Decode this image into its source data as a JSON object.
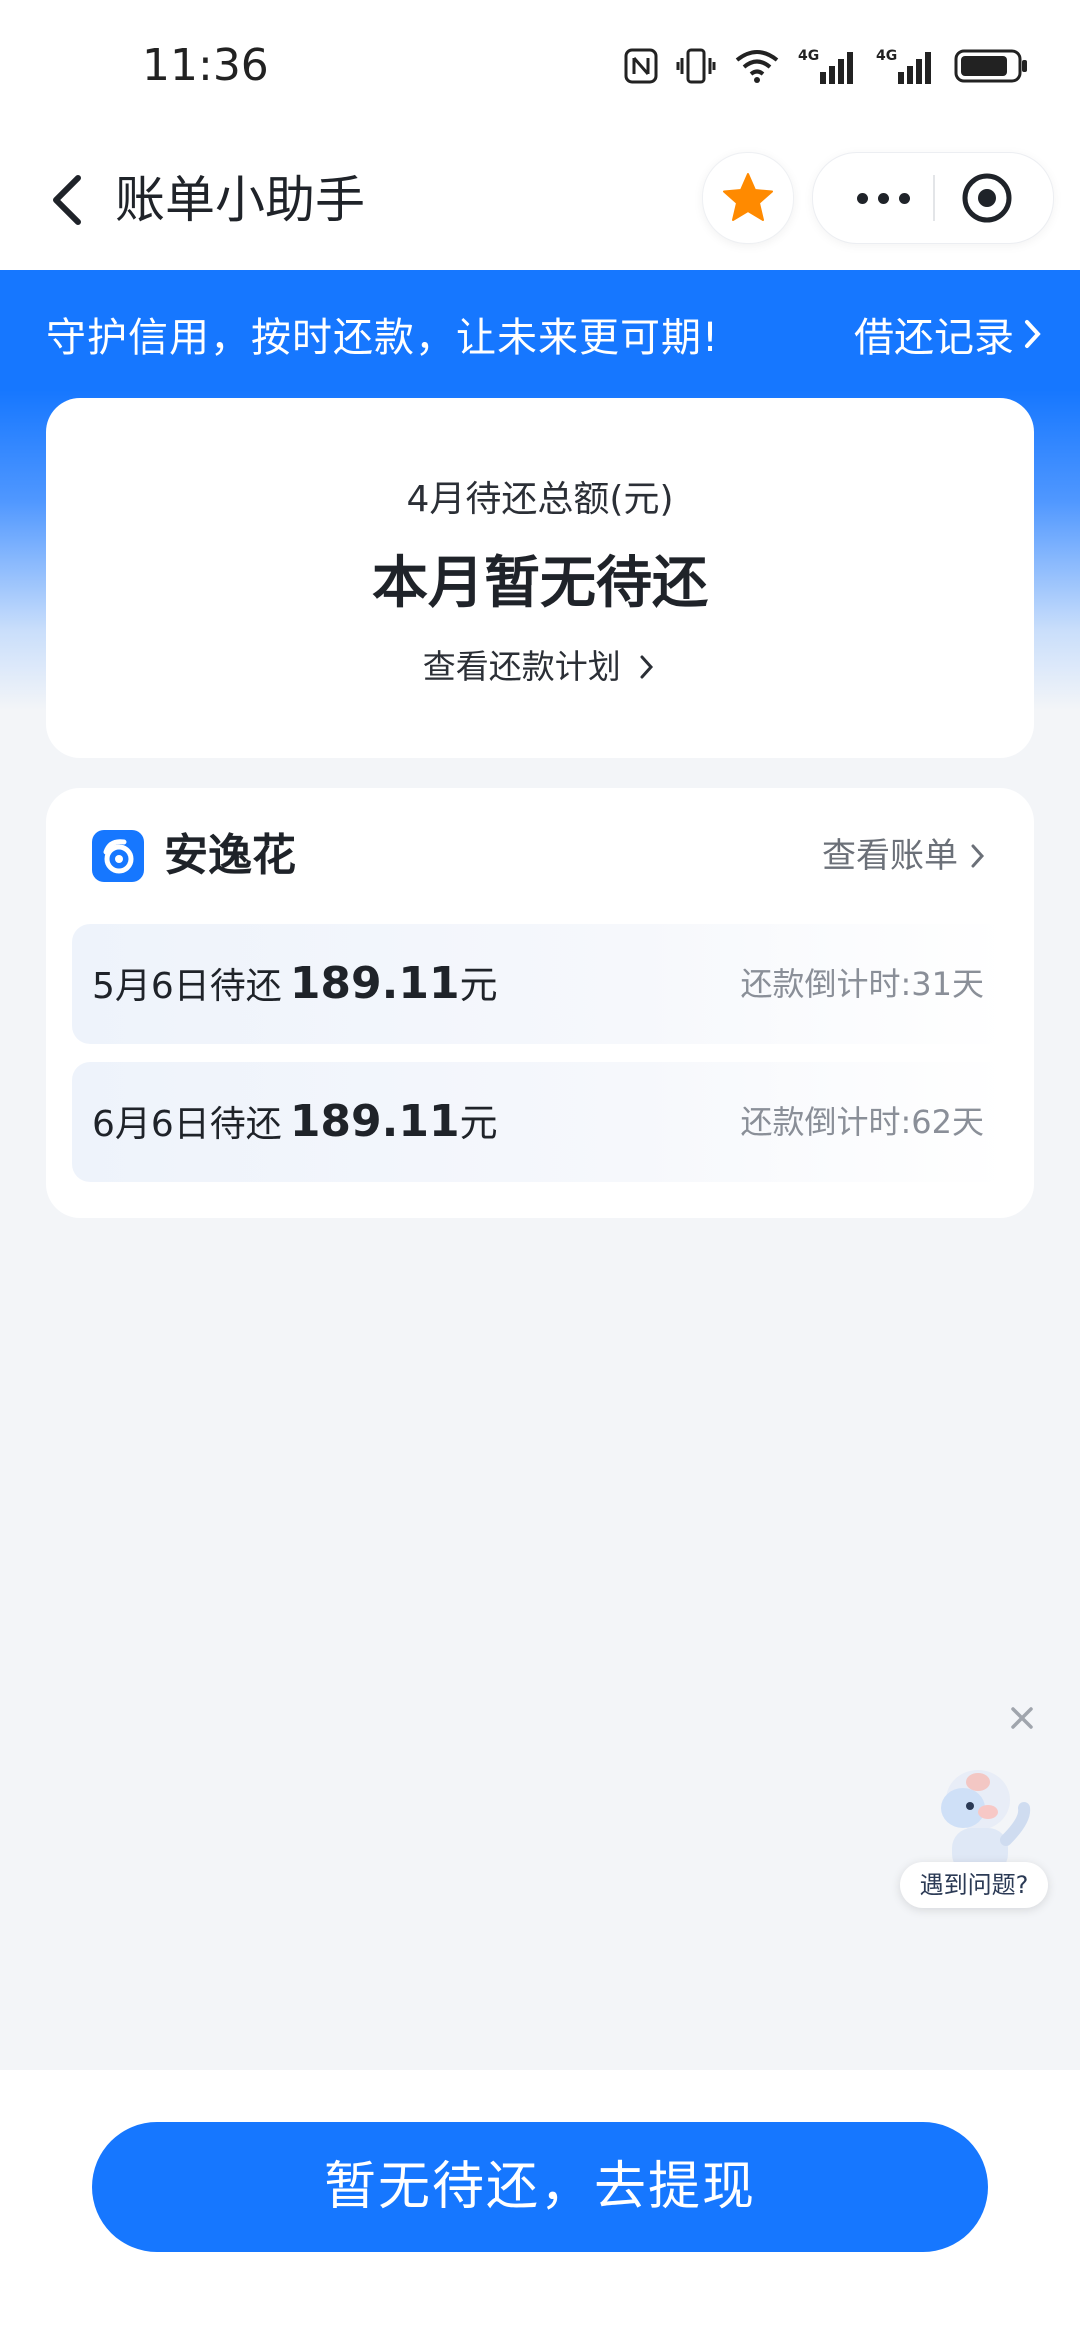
{
  "status_bar": {
    "time": "11:36",
    "icons": [
      "nfc-icon",
      "vibrate-icon",
      "wifi-icon",
      "signal-4g-icon",
      "signal-4g-icon",
      "battery-icon"
    ],
    "network_label_1": "4G",
    "network_label_2": "4G"
  },
  "nav": {
    "title": "账单小助手",
    "icons": [
      "back-arrow-icon",
      "star-icon",
      "more-icon",
      "close-target-icon"
    ]
  },
  "hero": {
    "slogan": "守护信用，按时还款，让未来更可期!",
    "history_link": "借还记录"
  },
  "summary": {
    "label": "4月待还总额(元)",
    "value": "本月暂无待还",
    "plan_link": "查看还款计划"
  },
  "loan": {
    "product_name": "安逸花",
    "view_bill": "查看账单",
    "bills": [
      {
        "due": "5月6日待还",
        "amount": "189.11",
        "unit": "元",
        "countdown": "还款倒计时:31天"
      },
      {
        "due": "6月6日待还",
        "amount": "189.11",
        "unit": "元",
        "countdown": "还款倒计时:62天"
      }
    ]
  },
  "help": {
    "label": "遇到问题?"
  },
  "cta": {
    "label": "暂无待还，去提现"
  },
  "colors": {
    "brand_blue": "#1677ff",
    "star_orange": "#ff8a00",
    "background": "#f3f5f8"
  }
}
